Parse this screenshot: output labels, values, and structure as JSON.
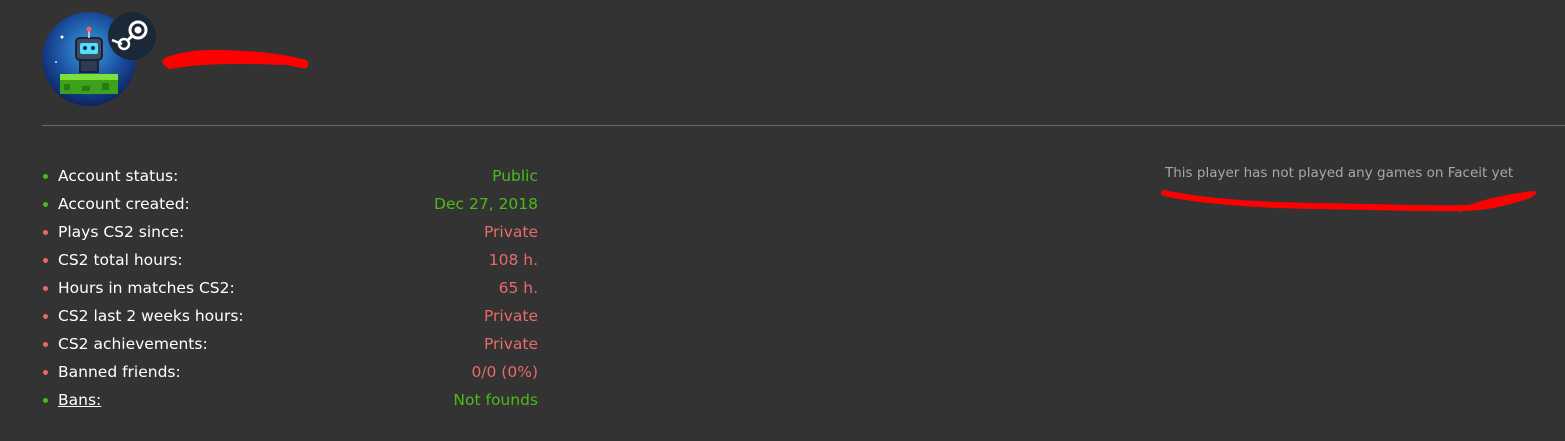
{
  "profile": {
    "avatar_icon": "robot-avatar-icon",
    "platform_icon": "steam-icon"
  },
  "stats": [
    {
      "label": "Account status:",
      "value": "Public",
      "status": "green"
    },
    {
      "label": "Account created:",
      "value": "Dec 27, 2018",
      "status": "green"
    },
    {
      "label": "Plays CS2 since:",
      "value": "Private",
      "status": "red"
    },
    {
      "label": "CS2 total hours:",
      "value": "108 h.",
      "status": "red"
    },
    {
      "label": "Hours in matches CS2:",
      "value": "65 h.",
      "status": "red"
    },
    {
      "label": "CS2 last 2 weeks hours:",
      "value": "Private",
      "status": "red"
    },
    {
      "label": "CS2 achievements:",
      "value": "Private",
      "status": "red"
    },
    {
      "label": "Banned friends:",
      "value": "0/0 (0%)",
      "status": "red"
    },
    {
      "label": "Bans:",
      "value": "Not founds",
      "status": "green"
    }
  ],
  "faceit": {
    "message": "This player has not played any games on Faceit yet"
  },
  "colors": {
    "background": "#333333",
    "good": "#4cbb17",
    "bad": "#e86a6a",
    "muted_text": "#a8a8a8",
    "annotation": "#ff0000"
  }
}
